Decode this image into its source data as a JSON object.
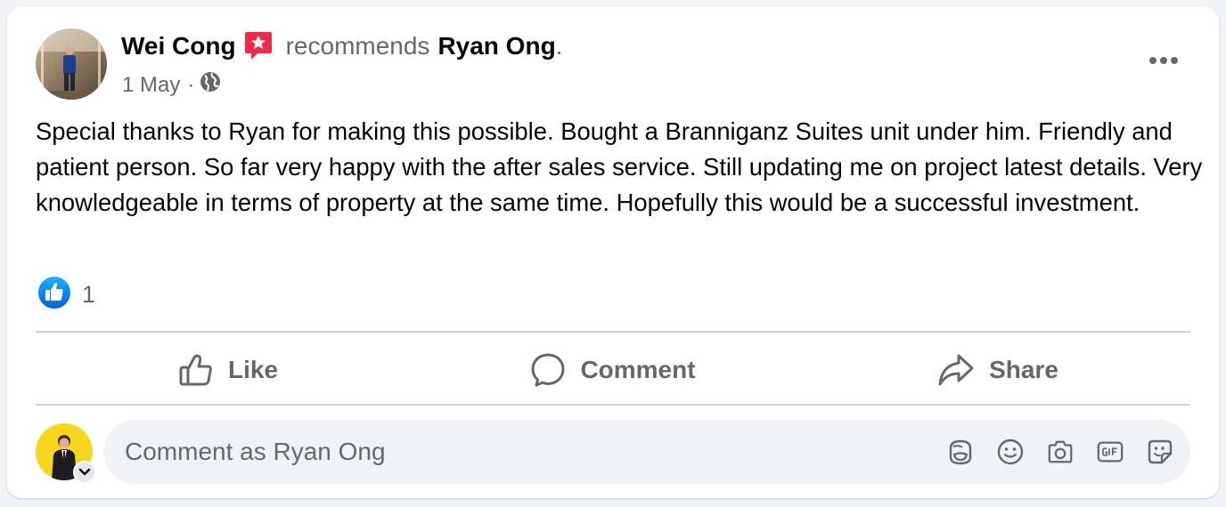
{
  "post": {
    "author": "Wei Cong",
    "verb": "recommends",
    "target": "Ryan Ong",
    "punctuation": ".",
    "date": "1 May",
    "separator": "·",
    "privacy_icon": "globe-icon",
    "badge_icon": "recommendation-star-badge-icon",
    "body": "Special thanks to Ryan for making this possible. Bought a Branniganz Suites unit under him. Friendly and patient person. So far very happy with the after sales service. Still updating me on project latest details. Very knowledgeable in terms of property at the same time. Hopefully this would be a successful investment."
  },
  "reactions": {
    "icon": "like-reaction-icon",
    "count": "1"
  },
  "actions": [
    {
      "label": "Like",
      "icon": "thumbs-up-icon"
    },
    {
      "label": "Comment",
      "icon": "comment-bubble-icon"
    },
    {
      "label": "Share",
      "icon": "share-arrow-icon"
    }
  ],
  "composer": {
    "placeholder": "Comment as Ryan Ong",
    "tools": [
      "avatar-sticker-icon",
      "emoji-icon",
      "camera-icon",
      "gif-icon",
      "sticker-icon"
    ]
  },
  "colors": {
    "background": "#f0f2f5",
    "card": "#ffffff",
    "primary_text": "#050505",
    "secondary_text": "#65676b",
    "like_blue": "#1877f2",
    "badge_red": "#f02849",
    "divider": "#ced0d4",
    "avatar_yellow": "#f7d71e"
  }
}
